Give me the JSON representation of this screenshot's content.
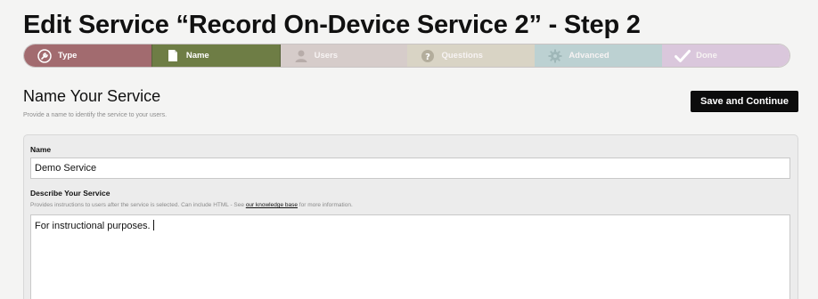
{
  "page": {
    "title": "Edit Service “Record On-Device Service 2” - Step 2"
  },
  "steps": [
    {
      "label": "Type",
      "icon": "wrench-icon"
    },
    {
      "label": "Name",
      "icon": "document-icon"
    },
    {
      "label": "Users",
      "icon": "user-icon"
    },
    {
      "label": "Questions",
      "icon": "question-icon"
    },
    {
      "label": "Advanced",
      "icon": "gear-icon"
    },
    {
      "label": "Done",
      "icon": "checkmark-icon"
    }
  ],
  "section": {
    "title": "Name Your Service",
    "subtitle": "Provide a name to identify the service to your users."
  },
  "actions": {
    "save_label": "Save and Continue"
  },
  "form": {
    "name_label": "Name",
    "name_value": "Demo Service",
    "describe_label": "Describe Your Service",
    "describe_help_before": "Provides instructions to users after the service is selected. Can include HTML - See ",
    "describe_help_link": "our knowledge base",
    "describe_help_after": " for more information.",
    "describe_value": "For instructional purposes."
  },
  "colors": {
    "step_type": "#a26b6f",
    "step_name_active": "#6e7d45",
    "step_users": "#d6ccca",
    "step_questions": "#d9d4c5",
    "step_advanced": "#bcd1d2",
    "step_done": "#dac7dc",
    "save_button": "#0c0c0c"
  }
}
